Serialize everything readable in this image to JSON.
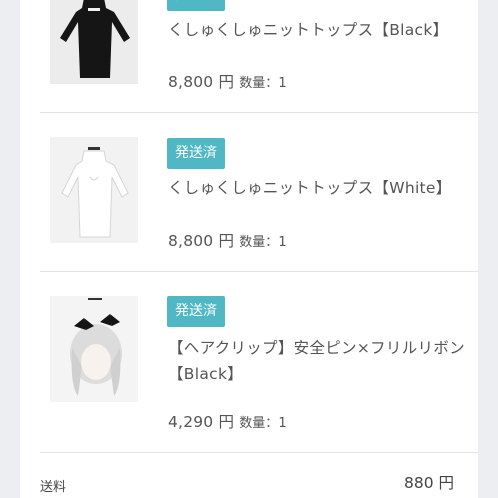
{
  "items": [
    {
      "title": "くしゅくしゅニットトップス【Black】",
      "price": "8,800 円",
      "qty_label": "数量：",
      "qty_value": "1"
    },
    {
      "badge": "発送済",
      "title": "くしゅくしゅニットトップス【White】",
      "price": "8,800 円",
      "qty_label": "数量：",
      "qty_value": "1"
    },
    {
      "badge": "発送済",
      "title": "【ヘアクリップ】安全ピン×フリルリボン【Black】",
      "price": "4,290 円",
      "qty_label": "数量：",
      "qty_value": "1"
    }
  ],
  "shipping": {
    "label": "送料",
    "value": "880 円"
  },
  "colors": {
    "badge": "#4fb8c4",
    "text": "#555555",
    "background": "#eceef1"
  }
}
